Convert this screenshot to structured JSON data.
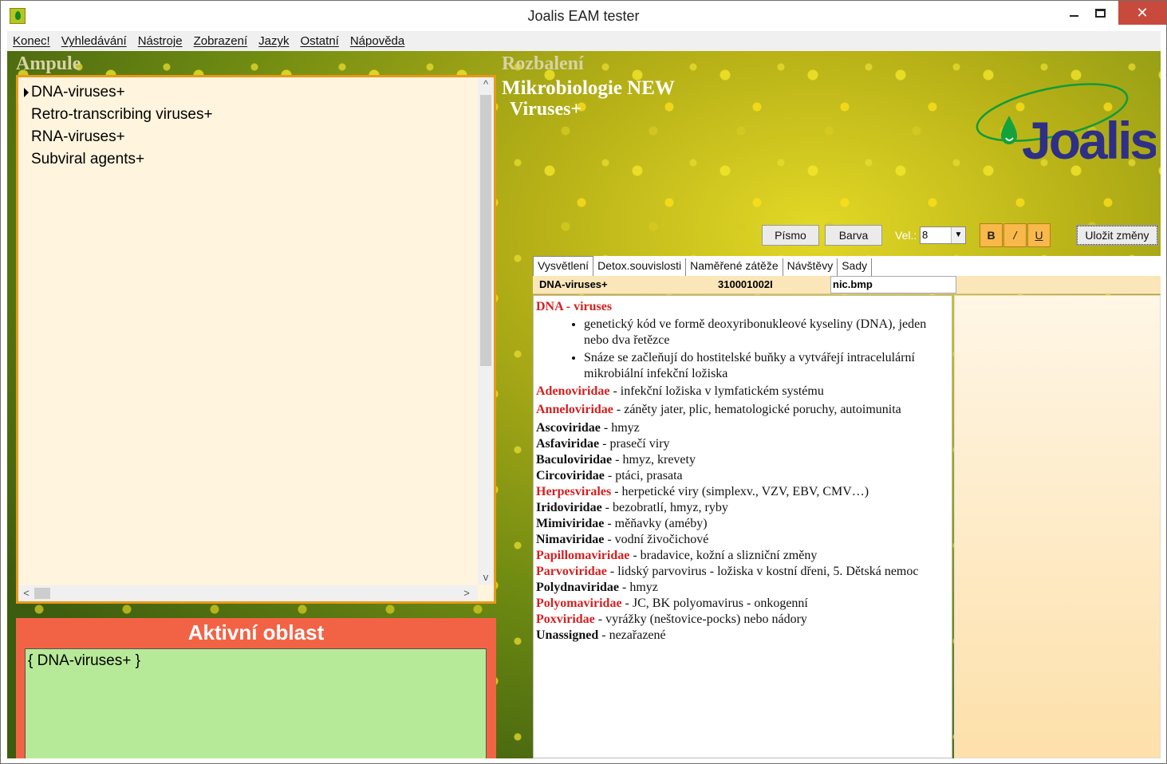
{
  "window": {
    "title": "Joalis EAM tester",
    "close_glyph": "✕"
  },
  "menu": [
    "Konec!",
    "Vyhledávání",
    "Nástroje",
    "Zobrazení",
    "Jazyk",
    "Ostatní",
    "Nápověda"
  ],
  "left": {
    "ampule_title": "Ampule",
    "items": [
      "DNA-viruses+",
      "Retro-transcribing viruses+",
      "RNA-viruses+",
      "Subviral agents+"
    ],
    "scroll_up": "^",
    "scroll_down": "v",
    "scroll_left": "<",
    "scroll_right": ">",
    "aktivni_title": "Aktivní oblast",
    "aktivni_text": "{ DNA-viruses+ }"
  },
  "right": {
    "rozbaleni_title": "Rozbalení",
    "mikro_title": "Mikrobiologie NEW",
    "viruses_title": "Viruses+",
    "logo_text": "Joalis",
    "toolbar": {
      "pismo": "Písmo",
      "barva": "Barva",
      "vel_label": "Vel.:",
      "vel_value": "8",
      "bold": "B",
      "italic": "/",
      "underline": "U",
      "save": "Uložit změny"
    },
    "tabs": [
      "Vysvětlení",
      "Detox.souvislosti",
      "Naměřené zátěže",
      "Návštěvy",
      "Sady"
    ],
    "info": {
      "name": "DNA-viruses+",
      "code": "310001002I",
      "file": "nic.bmp"
    },
    "desc": {
      "heading": "DNA - viruses",
      "bullets": [
        "genetický kód ve formě deoxyribonukleové kyseliny (DNA), jeden nebo dva řetězce",
        "Snáze se začleňují do hostitelské buňky a vytvářejí intracelulární mikrobiální infekční ložiska"
      ],
      "entries": [
        {
          "name": "Adenoviridae ",
          "text": " - infekční ložiska v lymfatickém systému",
          "red": true
        },
        {
          "name": "Anneloviridae",
          "text": " - záněty jater, plic, hematologické poruchy, autoimunita",
          "red": true
        },
        {
          "name": "Ascoviridae",
          "text": " - hmyz",
          "red": false
        },
        {
          "name": "Asfaviridae ",
          "text": " - prasečí viry",
          "red": false
        },
        {
          "name": "Baculoviridae",
          "text": " - hmyz, krevety",
          "red": false
        },
        {
          "name": "Circoviridae",
          "text": " - ptáci, prasata",
          "red": false
        },
        {
          "name": "Herpesvirales",
          "text": " - herpetické viry (simplexv., VZV, EBV, CMV…)",
          "red": true
        },
        {
          "name": "Iridoviridae",
          "text": " - bezobratlí, hmyz, ryby",
          "red": false
        },
        {
          "name": "Mimiviridae",
          "text": " - měňavky (améby)",
          "red": false
        },
        {
          "name": "Nimaviridae",
          "text": " - vodní živočichové",
          "red": false
        },
        {
          "name": "Papillomaviridae",
          "text": " - bradavice, kožní a slizniční změny",
          "red": true
        },
        {
          "name": "Parvoviridae",
          "text": " - lidský parvovirus - ložiska v kostní dřeni, 5. Dětská nemoc",
          "red": true
        },
        {
          "name": "Polydnaviridae",
          "text": " - hmyz",
          "red": false
        },
        {
          "name": "Polyomaviridae",
          "text": " - JC, BK polyomavirus - onkogenní",
          "red": true
        },
        {
          "name": "Poxviridae",
          "text": " - vyrážky (neštovice-pocks) nebo nádory",
          "red": true
        },
        {
          "name": "Unassigned",
          "text": " - nezařazené",
          "red": false
        }
      ]
    }
  }
}
